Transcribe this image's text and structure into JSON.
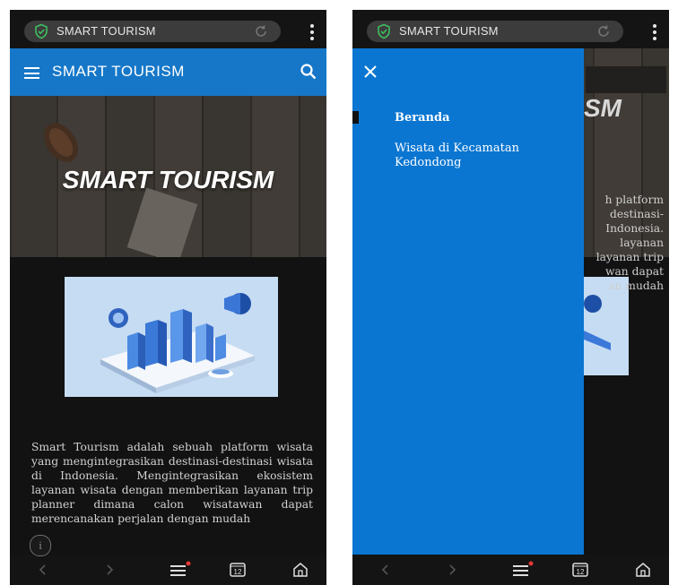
{
  "browser": {
    "url": "SMART TOURISM"
  },
  "appbar": {
    "title": "SMART TOURISM"
  },
  "hero": {
    "title": "SMART TOURISM"
  },
  "description": "Smart Tourism adalah sebuah platform wisata yang mengintegrasikan destinasi-destinasi wisata di Indonesia. Mengintegrasikan ekosistem layanan wisata dengan memberikan layanan trip planner dimana calon wisatawan dapat merencanakan perjalan dengan mudah",
  "drawer": {
    "items": [
      {
        "label": "Beranda",
        "active": true
      },
      {
        "label": "Wisata di Kecamatan Kedondong",
        "active": false
      }
    ]
  },
  "right_peek": {
    "hero_fragment": "SM",
    "text_fragments": [
      "h platform",
      "destinasi-",
      "Indonesia.",
      "layanan",
      "layanan trip",
      "wan dapat",
      "an mudah"
    ]
  },
  "bottom_bar": {
    "tabs_count": "12"
  },
  "colors": {
    "accent": "#1677c8",
    "drawer": "#0a76d1",
    "browser_bg": "#141414",
    "shield": "#3fbf5f"
  }
}
